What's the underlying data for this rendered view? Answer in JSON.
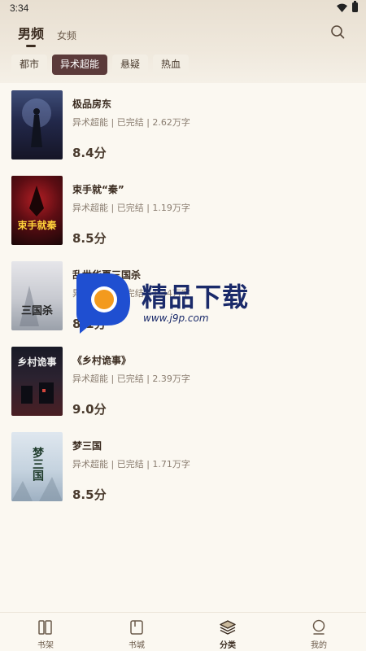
{
  "status": {
    "time": "3:34"
  },
  "gender_tabs": [
    {
      "label": "男频",
      "active": true
    },
    {
      "label": "女频",
      "active": false
    }
  ],
  "categories": [
    {
      "label": "都市",
      "active": false
    },
    {
      "label": "异术超能",
      "active": true
    },
    {
      "label": "悬疑",
      "active": false
    },
    {
      "label": "热血",
      "active": false
    }
  ],
  "books": [
    {
      "title": "极品房东",
      "meta": "异术超能 | 已完结 | 2.62万字",
      "score": "8.4分"
    },
    {
      "title": "束手就“秦”",
      "meta": "异术超能 | 已完结 | 1.19万字",
      "score": "8.5分",
      "cover_text": "束手就秦"
    },
    {
      "title": "乱世华夏三国杀",
      "meta": "异术超能 | 已完结 | 1.34万字",
      "score": "8.1分",
      "cover_text": "三国杀"
    },
    {
      "title": "《乡村诡事》",
      "meta": "异术超能 | 已完结 | 2.39万字",
      "score": "9.0分",
      "cover_text": "乡村诡事"
    },
    {
      "title": "梦三国",
      "meta": "异术超能 | 已完结 | 1.71万字",
      "score": "8.5分",
      "cover_text": "梦三国"
    }
  ],
  "watermark": {
    "text": "精品下载",
    "url": "www.j9p.com"
  },
  "bottom_nav": [
    {
      "label": "书架",
      "icon": "bookshelf-icon",
      "active": false
    },
    {
      "label": "书城",
      "icon": "bookstore-icon",
      "active": false
    },
    {
      "label": "分类",
      "icon": "category-icon",
      "active": true
    },
    {
      "label": "我的",
      "icon": "profile-icon",
      "active": false
    }
  ],
  "colors": {
    "accent": "#5b3a3a",
    "background": "#fbf8f1",
    "text": "#4a3b2e"
  }
}
